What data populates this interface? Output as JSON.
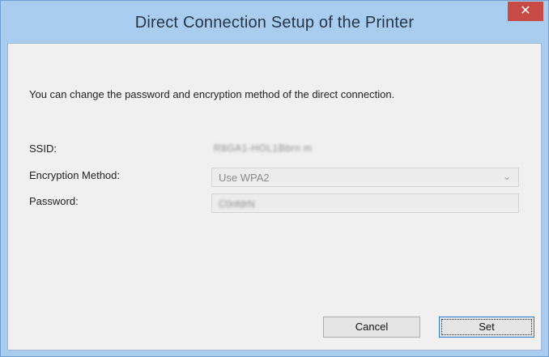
{
  "window": {
    "title": "Direct Connection Setup of the Printer",
    "close_glyph": "✕"
  },
  "dialog": {
    "description": "You can change the password and encryption method of the direct connection.",
    "fields": {
      "ssid_label": "SSID:",
      "ssid_value": "R8GA1-HOL1Bbrn m",
      "encryption_label": "Encryption Method:",
      "encryption_value": "Use WPA2",
      "password_label": "Password:",
      "password_value": "C0nfdrN"
    },
    "buttons": {
      "cancel": "Cancel",
      "set": "Set"
    }
  },
  "colors": {
    "titlebar": "#a9cdee",
    "close": "#c74a45",
    "client": "#f0f0f0"
  },
  "icons": {
    "close": "close-icon",
    "dropdown": "chevron-down-icon"
  }
}
